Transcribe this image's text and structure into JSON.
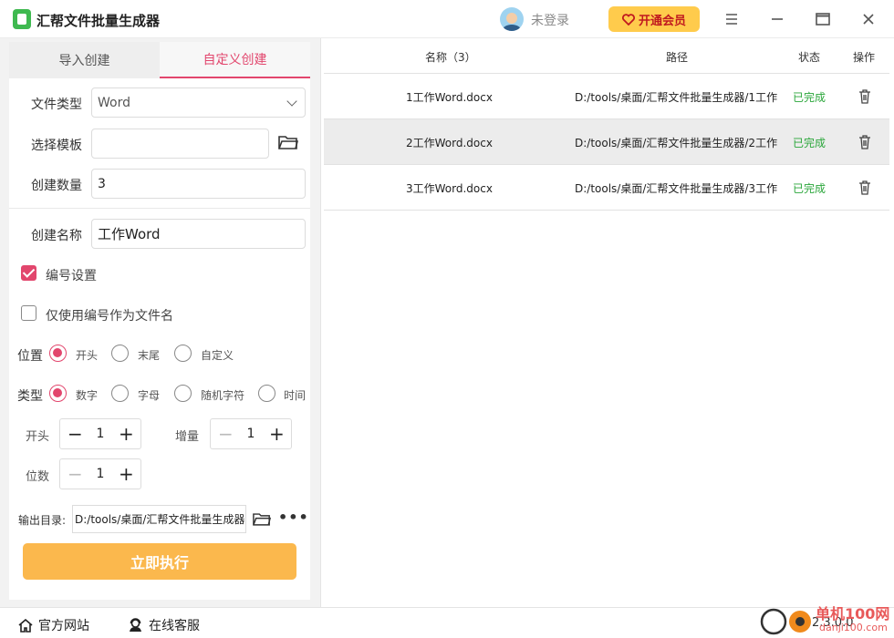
{
  "app": {
    "title": "汇帮文件批量生成器"
  },
  "header": {
    "login_text": "未登录",
    "vip_label": "开通会员"
  },
  "tabs": [
    {
      "label": "导入创建",
      "active": false
    },
    {
      "label": "自定义创建",
      "active": true
    }
  ],
  "form": {
    "file_type_label": "文件类型",
    "file_type_value": "Word",
    "template_label": "选择模板",
    "template_value": "",
    "count_label": "创建数量",
    "count_value": "3",
    "name_label": "创建名称",
    "name_value": "工作Word",
    "numbering_label": "编号设置",
    "numbering_checked": true,
    "only_number_label": "仅使用编号作为文件名",
    "only_number_checked": false,
    "position_label": "位置",
    "position_options": [
      "开头",
      "末尾",
      "自定义"
    ],
    "position_selected": "开头",
    "type_label": "类型",
    "type_options": [
      "数字",
      "字母",
      "随机字符",
      "时间"
    ],
    "type_selected": "数字",
    "start_label": "开头",
    "start_value": "1",
    "increment_label": "增量",
    "increment_value": "1",
    "digits_label": "位数",
    "digits_value": "1",
    "output_label": "输出目录:",
    "output_value": "D:/tools/桌面/汇帮文件批量生成器",
    "run_label": "立即执行"
  },
  "table": {
    "headers": {
      "name": "名称（3）",
      "path": "路径",
      "status": "状态",
      "action": "操作"
    },
    "rows": [
      {
        "name": "1工作Word.docx",
        "path": "D:/tools/桌面/汇帮文件批量生成器/1工作",
        "status": "已完成"
      },
      {
        "name": "2工作Word.docx",
        "path": "D:/tools/桌面/汇帮文件批量生成器/2工作",
        "status": "已完成"
      },
      {
        "name": "3工作Word.docx",
        "path": "D:/tools/桌面/汇帮文件批量生成器/3工作",
        "status": "已完成"
      }
    ]
  },
  "footer": {
    "website": "官方网站",
    "support": "在线客服",
    "version": "2.3.0.0",
    "watermark": "单机100网",
    "watermark_domain": "danji100.com"
  },
  "colors": {
    "accent": "#e2466d",
    "run_button": "#fbb84d",
    "vip": "#ffcb4c",
    "done": "#2aa63a"
  },
  "icons": [
    "app-logo-icon",
    "avatar-icon",
    "heart-icon",
    "menu-icon",
    "minimize-icon",
    "maximize-icon",
    "close-icon",
    "chevron-down-icon",
    "folder-icon",
    "more-icon",
    "trash-icon",
    "home-icon",
    "support-icon"
  ]
}
